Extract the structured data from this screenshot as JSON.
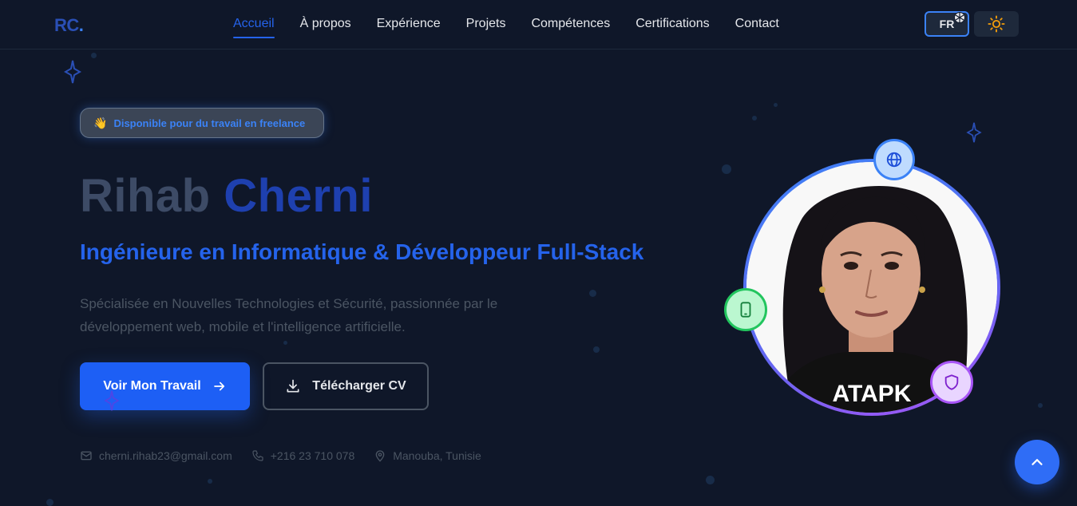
{
  "nav": {
    "logo_text": "RC",
    "logo_dot": ".",
    "links": [
      {
        "label": "Accueil",
        "active": true
      },
      {
        "label": "À propos"
      },
      {
        "label": "Expérience"
      },
      {
        "label": "Projets"
      },
      {
        "label": "Compétences"
      },
      {
        "label": "Certifications"
      },
      {
        "label": "Contact"
      }
    ],
    "lang_label": "FR",
    "lang_icon": "globe-icon",
    "theme_icon": "sun-icon"
  },
  "hero": {
    "badge_emoji": "👋",
    "badge_text": "Disponible pour du travail en freelance",
    "name_first": "Rihab",
    "name_last": "Cherni",
    "title": "Ingénieure en Informatique & Développeur Full-Stack",
    "description": "Spécialisée en Nouvelles Technologies et Sécurité, passionnée par le développement web, mobile et l'intelligence artificielle.",
    "primary_button": "Voir Mon Travail",
    "primary_icon": "arrow-right-icon",
    "secondary_button": "Télécharger CV",
    "secondary_icon": "download-icon"
  },
  "contact": {
    "email": "cherni.rihab23@gmail.com",
    "phone": "+216 23 710 078",
    "location": "Manouba, Tunisie"
  },
  "avatar": {
    "floating_icons": [
      "globe-icon",
      "smartphone-icon",
      "shield-icon"
    ],
    "shirt_text": "ATAPK"
  },
  "colors": {
    "background": "#0f1729",
    "accent": "#2563eb",
    "green": "#22c55e",
    "purple": "#a855f7"
  }
}
